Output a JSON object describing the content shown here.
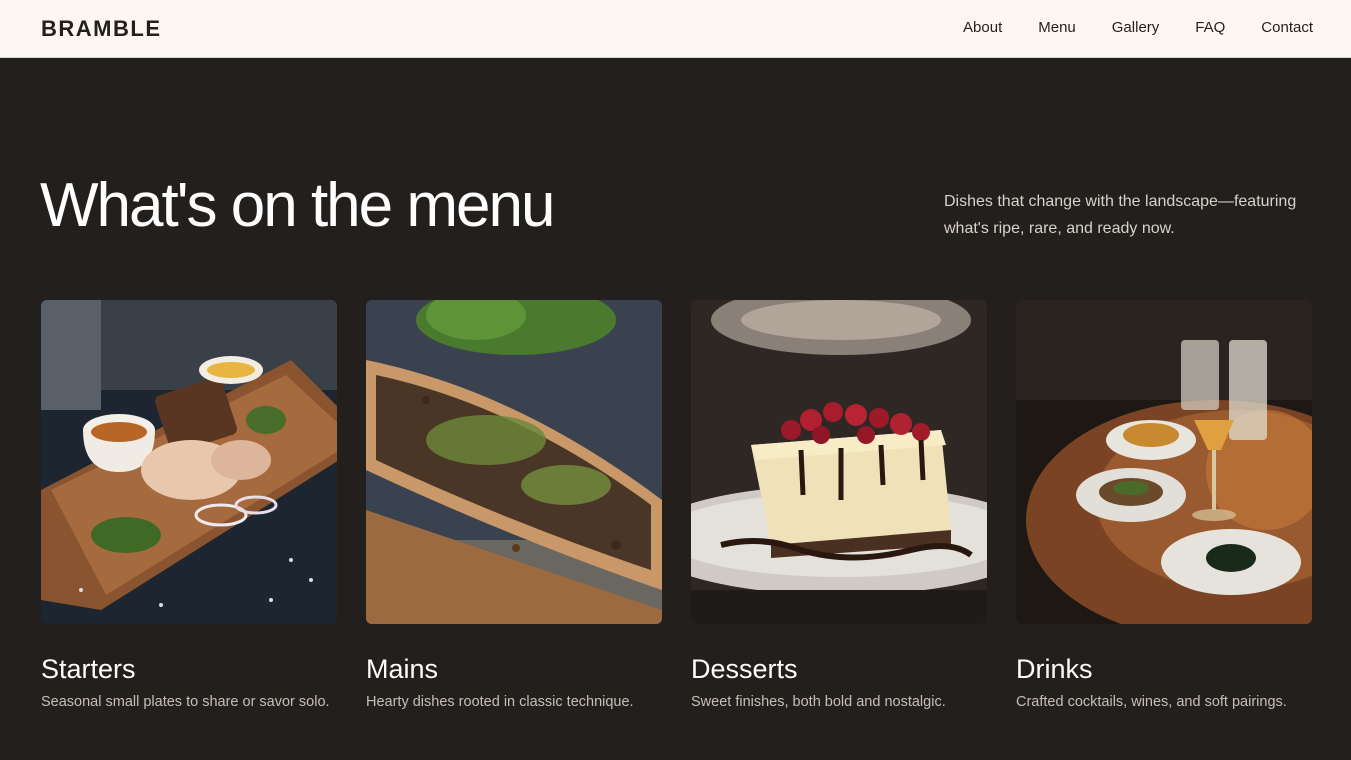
{
  "brand": {
    "name": "BRAMBLE"
  },
  "nav": {
    "items": [
      {
        "label": "About"
      },
      {
        "label": "Menu"
      },
      {
        "label": "Gallery"
      },
      {
        "label": "FAQ"
      },
      {
        "label": "Contact"
      }
    ]
  },
  "hero": {
    "title": "What's on the menu",
    "description": "Dishes that change with the landscape—featuring what's ripe, rare, and ready now."
  },
  "cards": [
    {
      "title": "Starters",
      "description": "Seasonal small plates to share or savor solo.",
      "image": "starters-photo"
    },
    {
      "title": "Mains",
      "description": "Hearty dishes rooted in classic technique.",
      "image": "mains-photo"
    },
    {
      "title": "Desserts",
      "description": "Sweet finishes, both bold and nostalgic.",
      "image": "desserts-photo"
    },
    {
      "title": "Drinks",
      "description": "Crafted cocktails, wines, and soft pairings.",
      "image": "drinks-photo"
    }
  ],
  "colors": {
    "page_background": "#231f1d",
    "header_background": "#fdf7f2",
    "text_light": "#ffffff",
    "text_muted": "#c6bfb8"
  }
}
